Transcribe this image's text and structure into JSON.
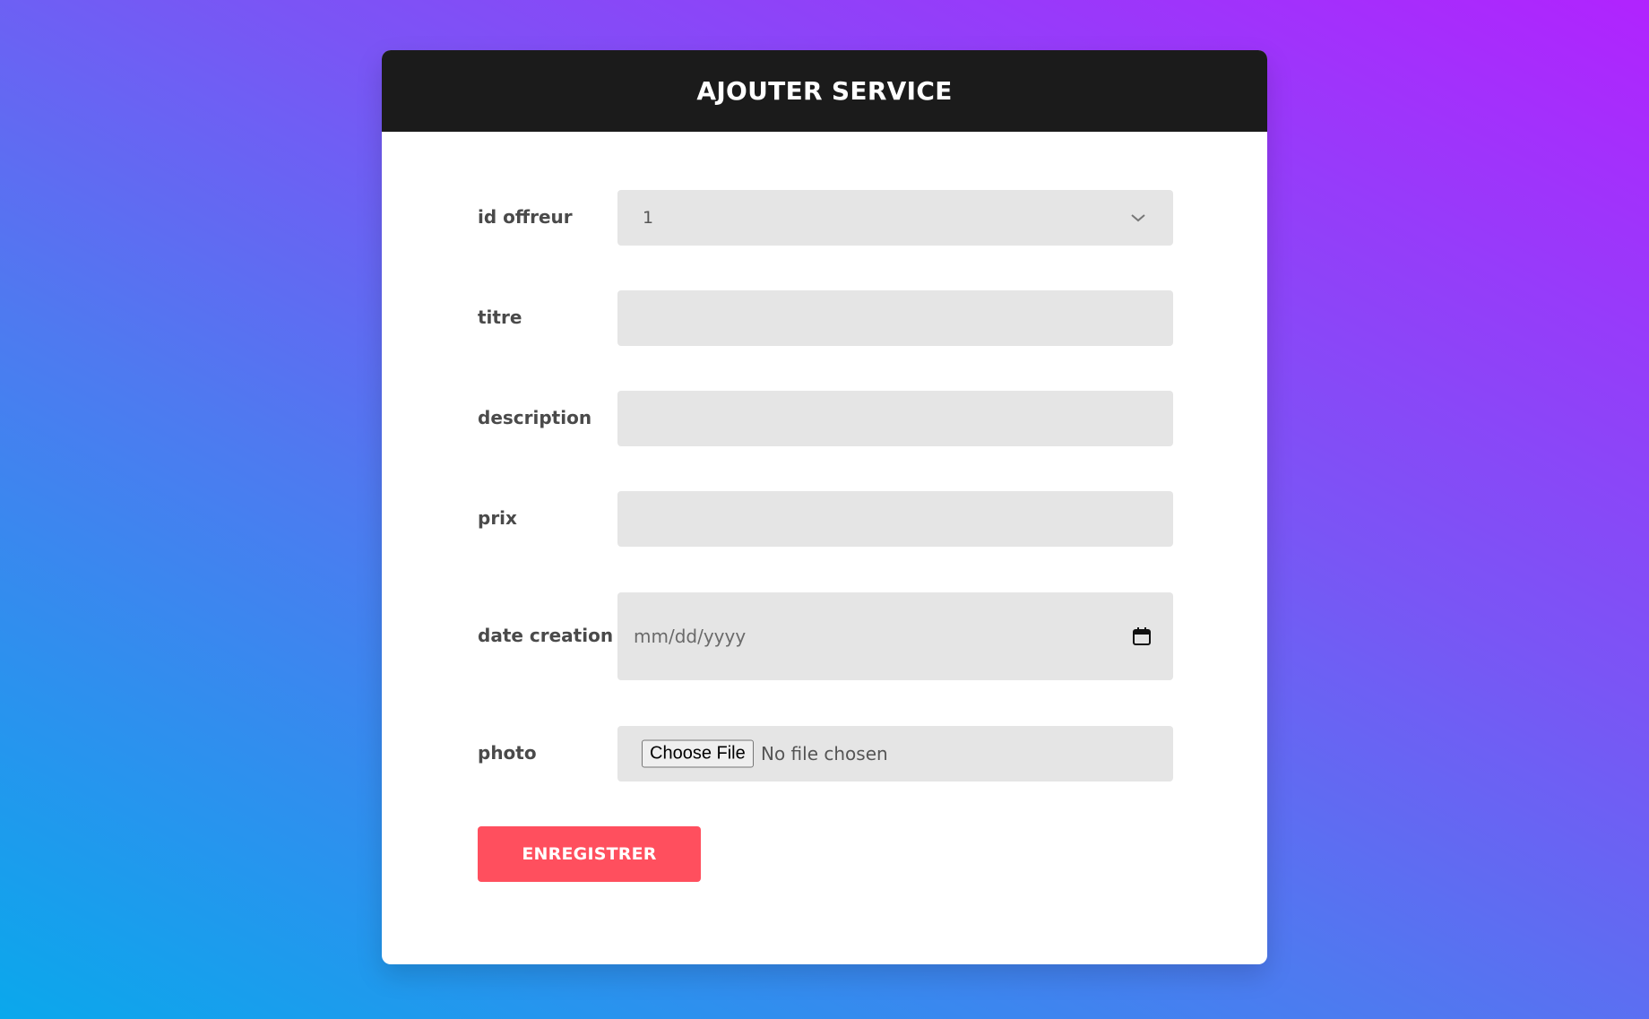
{
  "page": {
    "background_colors": [
      "#0aa8ec",
      "#7a55f5",
      "#b123fe"
    ]
  },
  "card": {
    "title": "AJOUTER SERVICE",
    "header_color": "#1b1b1b"
  },
  "form": {
    "id_offreur": {
      "label": "id offreur",
      "selected_value": "1",
      "icon": "chevron-down-icon"
    },
    "titre": {
      "label": "titre",
      "value": ""
    },
    "description": {
      "label": "description",
      "value": ""
    },
    "prix": {
      "label": "prix",
      "value": ""
    },
    "date_creation": {
      "label": "date creation",
      "placeholder": "mm/dd/yyyy",
      "icon": "calendar-icon"
    },
    "photo": {
      "label": "photo",
      "button_label": "Choose File",
      "status": "No file chosen"
    },
    "submit_label": "ENREGISTRER",
    "submit_color": "#ff4f5e"
  }
}
